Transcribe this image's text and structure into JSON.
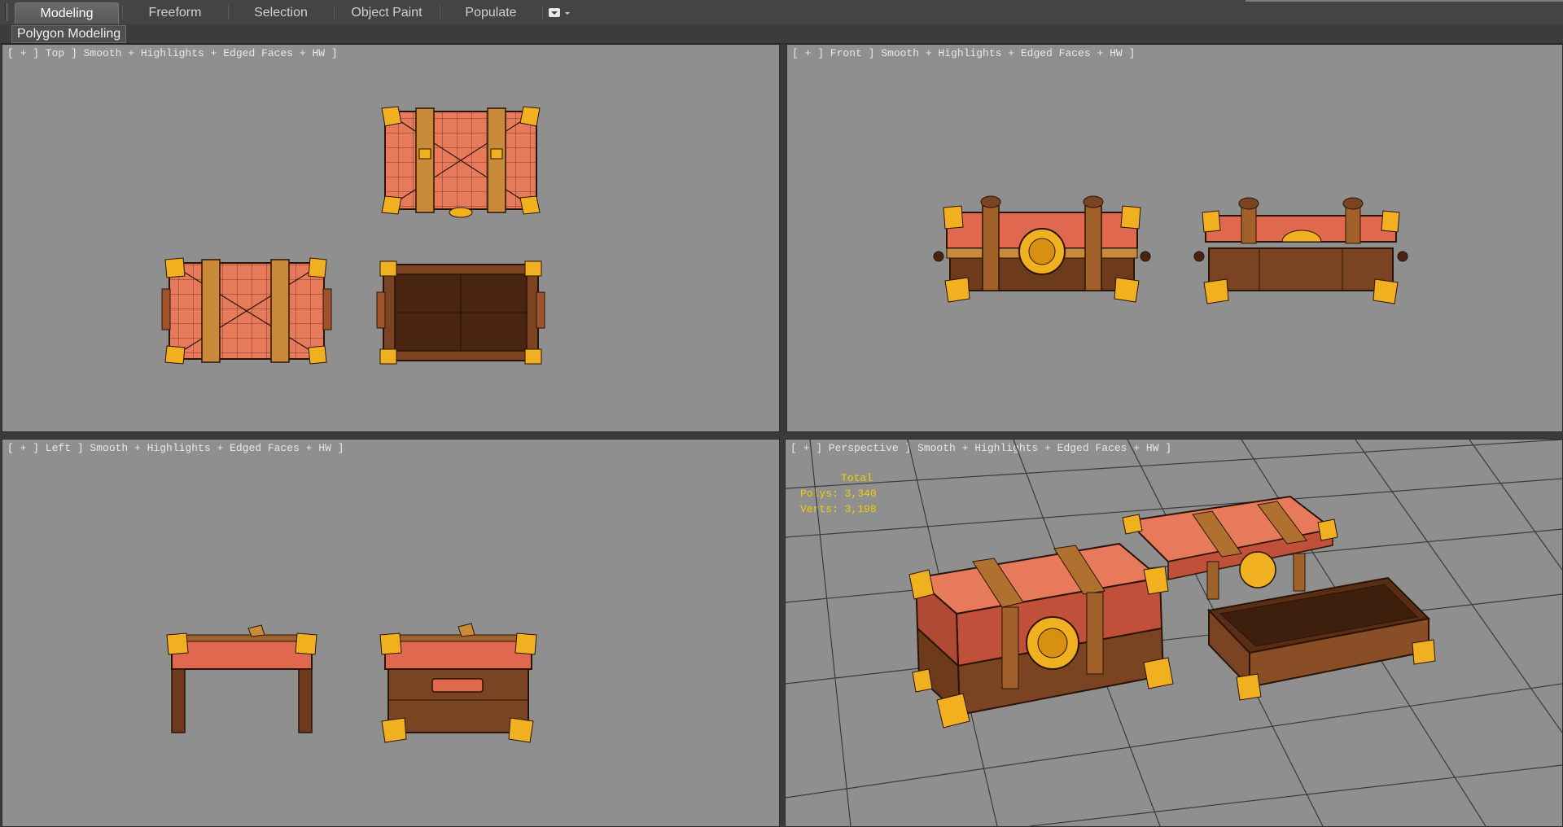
{
  "ribbon": {
    "tabs": [
      {
        "label": "Modeling",
        "active": true
      },
      {
        "label": "Freeform",
        "active": false
      },
      {
        "label": "Selection",
        "active": false
      },
      {
        "label": "Object Paint",
        "active": false
      },
      {
        "label": "Populate",
        "active": false
      }
    ],
    "menu_icon": "ribbon-options-icon",
    "panel_title": "Polygon Modeling"
  },
  "viewports": {
    "top": {
      "label": "[ + ] Top ] Smooth + Highlights + Edged Faces + HW ]"
    },
    "front": {
      "label": "[ + ] Front ] Smooth + Highlights + Edged Faces + HW ]"
    },
    "left": {
      "label": "[ + ] Left ] Smooth + Highlights + Edged Faces + HW ]"
    },
    "perspective": {
      "label": "[ + ] Perspective ] Smooth + Highlights + Edged Faces + HW ]"
    }
  },
  "statistics": {
    "total_label": "Total",
    "polys": "Polys: 3,340",
    "verts": "Verts: 3,198"
  },
  "colors": {
    "viewport_bg": "#8f8f8f",
    "lid_red": "#e0684e",
    "wood_brown": "#6e3a1c",
    "gold": "#f0b020",
    "stats_yellow": "#f0d000"
  }
}
